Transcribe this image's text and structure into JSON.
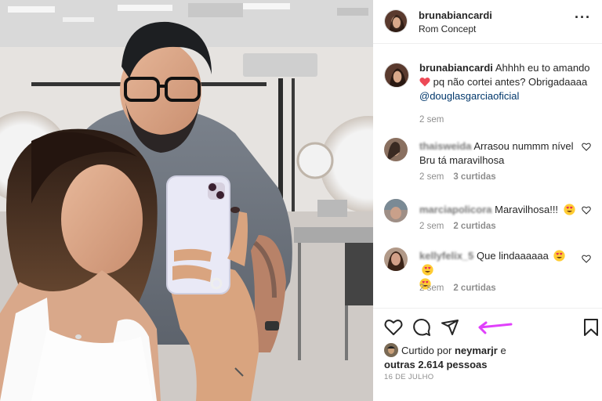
{
  "header": {
    "username": "brunabiancardi",
    "location": "Rom Concept",
    "more_icon": "more-horizontal-icon"
  },
  "caption": {
    "username": "brunabiancardi",
    "text_part1": "Ahhhh eu to amando",
    "text_part2": "pq não cortei antes? Obrigadaaaa",
    "mention": "@douglasgarciaoficial",
    "time": "2 sem"
  },
  "comments": [
    {
      "username": "thaisweida",
      "text": "Arrasou nummm nível Bru tá maravilhosa",
      "time": "2 sem",
      "likes": "3 curtidas"
    },
    {
      "username": "marciapolicora",
      "text": "Maravilhosa!!!",
      "time": "2 sem",
      "likes": "2 curtidas"
    },
    {
      "username": "kellyfelix_5",
      "text": "Que lindaaaaaa",
      "time": "2 sem",
      "likes": "2 curtidas"
    }
  ],
  "actions": {
    "like_icon": "heart-icon",
    "comment_icon": "comment-icon",
    "share_icon": "share-icon",
    "save_icon": "bookmark-icon"
  },
  "likes": {
    "prefix": "Curtido por",
    "user": "neymarjr",
    "suffix": "e",
    "others": "outras 2.614 pessoas"
  },
  "date": "16 DE JULHO",
  "colors": {
    "heart_red": "#ed4956",
    "mention_blue": "#00376b",
    "annotation_arrow": "#e040fb"
  }
}
